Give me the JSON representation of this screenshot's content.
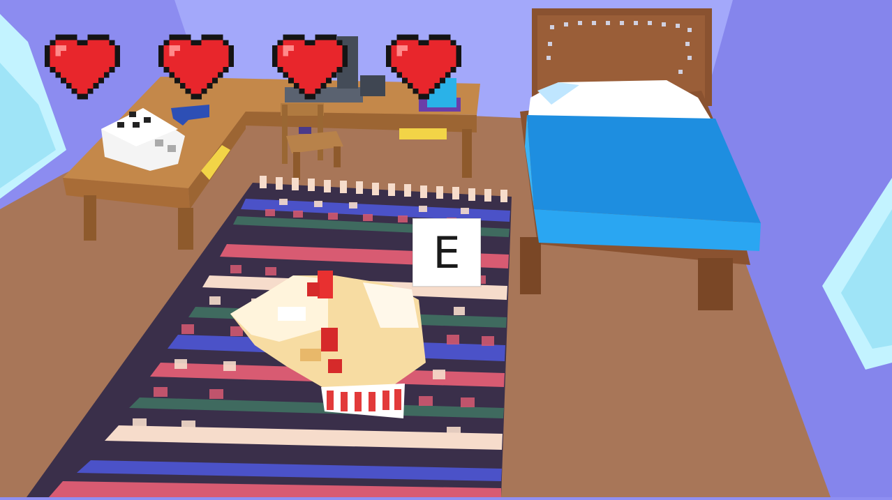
{
  "hud": {
    "hearts": [
      {
        "icon": "heart-icon",
        "state": "full"
      },
      {
        "icon": "heart-icon",
        "state": "full"
      },
      {
        "icon": "heart-icon",
        "state": "full"
      },
      {
        "icon": "heart-icon",
        "state": "full"
      }
    ],
    "heart_color": "#e8262c",
    "heart_outline": "#141414"
  },
  "prompt": {
    "key": "E"
  },
  "scene": {
    "colors": {
      "wall": "#8f8ff2",
      "wall_light": "#aab0fb",
      "floor": "#a87658",
      "desk": "#b5783d",
      "bed_frame": "#8a5230",
      "blanket": "#1e8ee0",
      "pillow": "#ffffff",
      "curtain": "#bff2ff",
      "rug_dark": "#3a2f4a",
      "rug_green": "#3f6a5f",
      "rug_pink": "#d85b72",
      "rug_blue": "#4b52c8",
      "rug_cream": "#f6dccb"
    }
  }
}
